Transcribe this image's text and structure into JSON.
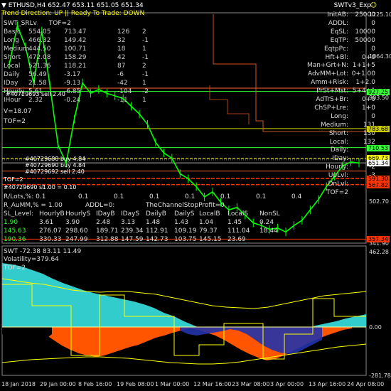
{
  "header": {
    "symbol_line": "ETHUSD,H4  652.47 653.11 651.05 651.34",
    "trend_label": "Trend Direction:",
    "trend_value": "UP",
    "sep": "||",
    "ready_label": "Ready To Trade:",
    "ready_value": "DOWN",
    "expert_name": "SWTv3_Exp",
    "expert_face": "☺"
  },
  "swt_header": {
    "name": "SWT_SRLv",
    "tof": "TOF=2"
  },
  "levels_table": [
    {
      "label": "Basic",
      "c1": "554.05",
      "c2": "713.47",
      "c3": "126",
      "c4": "2"
    },
    {
      "label": "Long",
      "c1": "466.32",
      "c2": "149.42",
      "c3": "32",
      "c4": "-1"
    },
    {
      "label": "Medium",
      "c1": "444.50",
      "c2": "100.71",
      "c3": "18",
      "c4": "1"
    },
    {
      "label": "Short",
      "c1": "472.08",
      "c2": "158.29",
      "c3": "42",
      "c4": "-1"
    },
    {
      "label": "Local",
      "c1": "521.36",
      "c2": "118.21",
      "c3": "87",
      "c4": "2"
    },
    {
      "label": "Daily",
      "c1": "56.49",
      "c2": "-3.17",
      "c3": "-6",
      "c4": "-1"
    },
    {
      "label": "IDay",
      "c1": "21.58",
      "c2": "-9.13",
      "c3": "-42",
      "c4": "1"
    },
    {
      "label": "Hourly",
      "c1": "5.61",
      "c2": "-6.85",
      "c3": "-104",
      "c4": "-2"
    },
    {
      "label": "IHour",
      "c1": "2.32",
      "c2": "-0.24",
      "c3": "-11",
      "c4": "1"
    }
  ],
  "v_line": "V=18.07",
  "tof_line": "TOF=2",
  "params": [
    {
      "label": "InitAB:",
      "value": "25000"
    },
    {
      "label": "ADDL:",
      "value": "0"
    },
    {
      "label": "EqSL:",
      "value": "10000"
    },
    {
      "label": "EqTP:",
      "value": "50000"
    },
    {
      "label": "EqtpPc:",
      "value": "0"
    },
    {
      "label": "Hft+Bl:",
      "value": "0+0"
    },
    {
      "label": "Man+Grt+N:",
      "value": "1+1+5"
    },
    {
      "label": "AdvMM+Lot:",
      "value": "0+1.00"
    },
    {
      "label": "Amm+Risk:",
      "value": "1+2.0"
    },
    {
      "label": "PrSt+Mst:",
      "value": "5+4+1"
    },
    {
      "label": "AdTrS+Br:",
      "value": "0+0"
    },
    {
      "label": "ChSP+Lre:",
      "value": "1+0"
    },
    {
      "label": "Long:",
      "value": "0"
    },
    {
      "label": "Medium:",
      "value": "131"
    },
    {
      "label": "Short:",
      "value": "130"
    },
    {
      "label": "Local:",
      "value": "132"
    },
    {
      "label": "Daily:",
      "value": "-1"
    },
    {
      "label": "IDay:",
      "value": "-1"
    },
    {
      "label": "Hourly:",
      "value": "-2"
    },
    {
      "label": "UpLvl:",
      "value": "-3"
    },
    {
      "label": "DnLvl:",
      "value": "3"
    },
    {
      "label": "TOF=2",
      "value": ""
    }
  ],
  "orders": {
    "o1": "#40729693 sell 2.40",
    "o2": "#40729688 buy 4.84",
    "o3": "#40729690 buy 4.84",
    "o4": "#40729692 sell 2.40",
    "tof": "TOF=2",
    "sl": "#40729690 sl"
  },
  "left_misc": {
    "ta_line": "1.00 = 0.10",
    "rlots": "R/Lots,%: 0.1",
    "rlots_vals": [
      "0.1",
      "0.1",
      "0.1",
      "0.1",
      "0.1",
      "0.1",
      "0.4"
    ],
    "r_aumm": "R_AuMM,% = 1.00",
    "addl": "ADDL=0:",
    "stop": "TheChannelStopProfit=0"
  },
  "sl_table": {
    "headers": [
      "SL_Level:",
      "HourlyB",
      "HourlyS",
      "IDayB",
      "IDayS",
      "DailyB",
      "DailyS",
      "LocalB",
      "LocalS",
      "NonSL"
    ],
    "rows": [
      {
        "lead": "1.90",
        "values": [
          "3.61",
          "3.90",
          "2.48",
          "3.13",
          "1.48",
          "1.43",
          "1.04",
          "1.45",
          "0.24"
        ],
        "color": "#33ff33"
      },
      {
        "lead": "145.63",
        "values": [
          "276.07",
          "298.60",
          "189.71",
          "239.34",
          "112.91",
          "109.19",
          "79.37",
          "111.04",
          "18.44"
        ],
        "color": "#33ff33"
      },
      {
        "lead": "190.36",
        "values": [
          "330.33",
          "247.99",
          "312.88",
          "147.59",
          "142.73",
          "103.75",
          "145.15",
          "23.69",
          ""
        ],
        "color": "#33ff33"
      }
    ]
  },
  "price_axis": [
    {
      "text": "1225.10"
    },
    {
      "text": "1064.30"
    },
    {
      "text": "903.50"
    },
    {
      "text": "663.31"
    },
    {
      "text": "502.70"
    },
    {
      "text": "341.90"
    }
  ],
  "price_labels": [
    {
      "text": "927.25",
      "color": "#33ff33"
    },
    {
      "text": "783.68",
      "color": "#cccc00"
    },
    {
      "text": "710.53",
      "color": "#33ff33"
    },
    {
      "text": "669.73",
      "color": "#ffff00"
    },
    {
      "text": "651.34",
      "color": "#ffffff"
    },
    {
      "text": "591.30",
      "color": "#ff3300"
    },
    {
      "text": "567.82",
      "color": "#ff3300"
    },
    {
      "text": "357.34",
      "color": "#ff3300"
    }
  ],
  "sub_header": {
    "line": "SWT -72.38 83.11 11.49",
    "vol": "Volatility=379.64",
    "tof": "TOF=2"
  },
  "sub_axis": [
    {
      "text": "462.28"
    },
    {
      "text": "0.00"
    },
    {
      "text": "-281.78"
    }
  ],
  "time_axis": [
    "18 Jan 2018",
    "29 Jan 00:00",
    "8 Feb 16:00",
    "19 Feb 08:00",
    "1 Mar 00:00",
    "12 Mar 16:00",
    "23 Mar 08:00",
    "3 Apr 00:00",
    "13 Apr 16:00",
    "24 Apr 08:00"
  ],
  "colors": {
    "price": "#00ff00",
    "support": "#ff3300",
    "resistance": "#33ff33",
    "yellow": "#ffff00",
    "cyan": "#33cccc",
    "orange": "#ff5500",
    "navy": "#2233aa"
  },
  "chart_data": {
    "type": "line",
    "title": "ETHUSD,H4",
    "ylim": [
      341.9,
      1225.1
    ],
    "x": [
      "18 Jan 2018",
      "29 Jan 00:00",
      "8 Feb 16:00",
      "19 Feb 08:00",
      "1 Mar 00:00",
      "12 Mar 16:00",
      "23 Mar 08:00",
      "3 Apr 00:00",
      "13 Apr 16:00",
      "24 Apr 08:00"
    ],
    "series": [
      {
        "values": [
          1030,
          1180,
          1100,
          960,
          1160,
          950,
          720,
          650,
          820,
          960,
          920,
          935,
          920,
          910,
          900,
          870,
          840,
          800,
          730,
          690,
          670,
          610,
          590,
          560,
          520,
          540,
          500,
          470,
          480,
          450,
          420,
          410,
          395,
          400,
          385,
          410,
          430,
          470,
          510,
          560,
          600,
          640,
          655,
          651
        ]
      }
    ]
  }
}
